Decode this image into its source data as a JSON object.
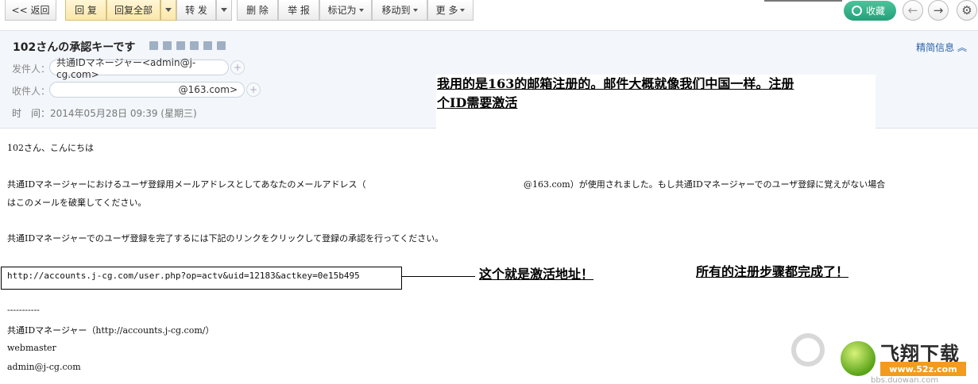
{
  "toolbar": {
    "back": "<< 返回",
    "reply": "回 复",
    "reply_all": "回复全部",
    "forward": "转 发",
    "delete": "删 除",
    "report": "举 报",
    "mark_as": "标记为",
    "move_to": "移动到",
    "more": "更 多",
    "favorite": "收藏"
  },
  "email": {
    "subject": "102さんの承認キーです",
    "detail_toggle": "精简信息",
    "sender_label": "发件人：",
    "sender": "共通IDマネージャー<admin@j-cg.com>",
    "recipient_label": "收件人：",
    "recipient": "@163.com>",
    "time_label": "时　间：",
    "time_value": "2014年05月28日 09:39 (星期三)"
  },
  "body": {
    "greeting": "102さん、こんにちは",
    "para1_line1": "共通IDマネージャーにおけるユーザ登録用メールアドレスとしてあなたのメールアドレス（",
    "para1_email": "@163.com）が使用されました。もし共通IDマネージャーでのユーザ登録に覚えがない場合",
    "para1_line2": "はこのメールを破棄してください。",
    "para2": "共通IDマネージャーでのユーザ登録を完了するには下記のリンクをクリックして登録の承認を行ってください。",
    "link": "http://accounts.j-cg.com/user.php?op=actv&uid=12183&actkey=0e15b495",
    "separator": "-----------",
    "sig_name": "共通IDマネージャー（http://accounts.j-cg.com/）",
    "sig_role": "webmaster",
    "sig_email": "admin@j-cg.com"
  },
  "annotations": {
    "top_line1": "我用的是163的邮箱注册的。邮件大概就像我们中国一样。注册",
    "top_line2": "个ID需要激活",
    "activation": "这个就是激活地址！",
    "done": "所有的注册步骤都完成了！"
  },
  "watermark": {
    "title": "飞翔下载",
    "url": "www.52z.com",
    "small": "bbs.duowan.com"
  }
}
